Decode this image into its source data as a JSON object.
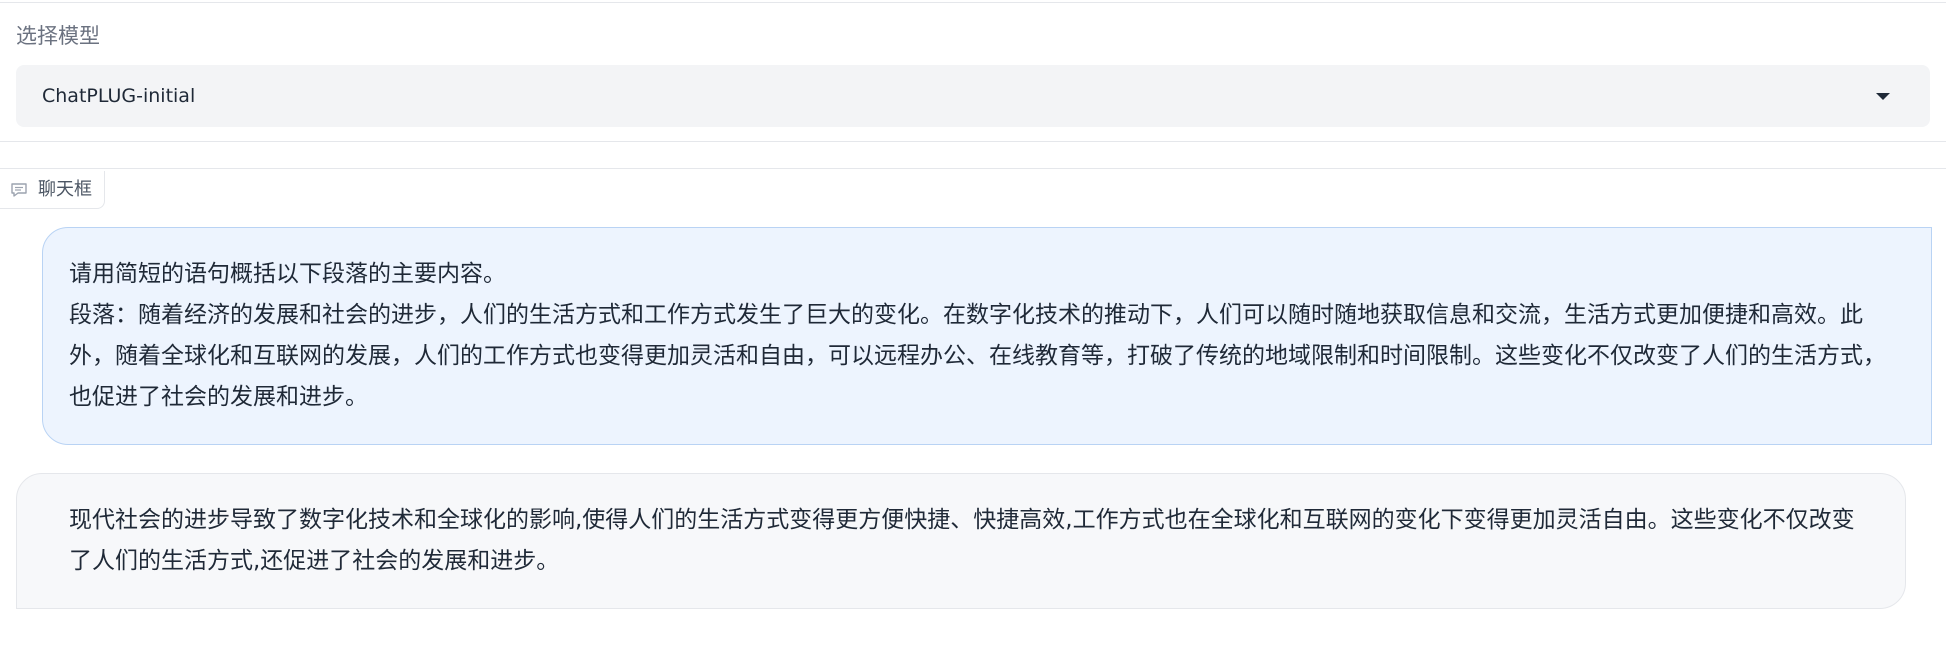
{
  "model_selector": {
    "label": "选择模型",
    "value": "ChatPLUG-initial",
    "caret_icon": "caret-down-icon"
  },
  "chatbot": {
    "label": "聊天框",
    "label_icon": "chat-icon",
    "messages": [
      {
        "role": "user",
        "text": "请用简短的语句概括以下段落的主要内容。\n段落：随着经济的发展和社会的进步，人们的生活方式和工作方式发生了巨大的变化。在数字化技术的推动下，人们可以随时随地获取信息和交流，生活方式更加便捷和高效。此外，随着全球化和互联网的发展，人们的工作方式也变得更加灵活和自由，可以远程办公、在线教育等，打破了传统的地域限制和时间限制。这些变化不仅改变了人们的生活方式，也促进了社会的发展和进步。"
      },
      {
        "role": "bot",
        "text": "现代社会的进步导致了数字化技术和全球化的影响,使得人们的生活方式变得更方便快捷、快捷高效,工作方式也在全球化和互联网的变化下变得更加灵活自由。这些变化不仅改变了人们的生活方式,还促进了社会的发展和进步。"
      }
    ]
  },
  "colors": {
    "user_bubble_bg": "#edf4fe",
    "user_bubble_border": "#b9d3f4",
    "bot_bubble_bg": "#f7f8fa",
    "select_bg": "#f3f4f6"
  }
}
